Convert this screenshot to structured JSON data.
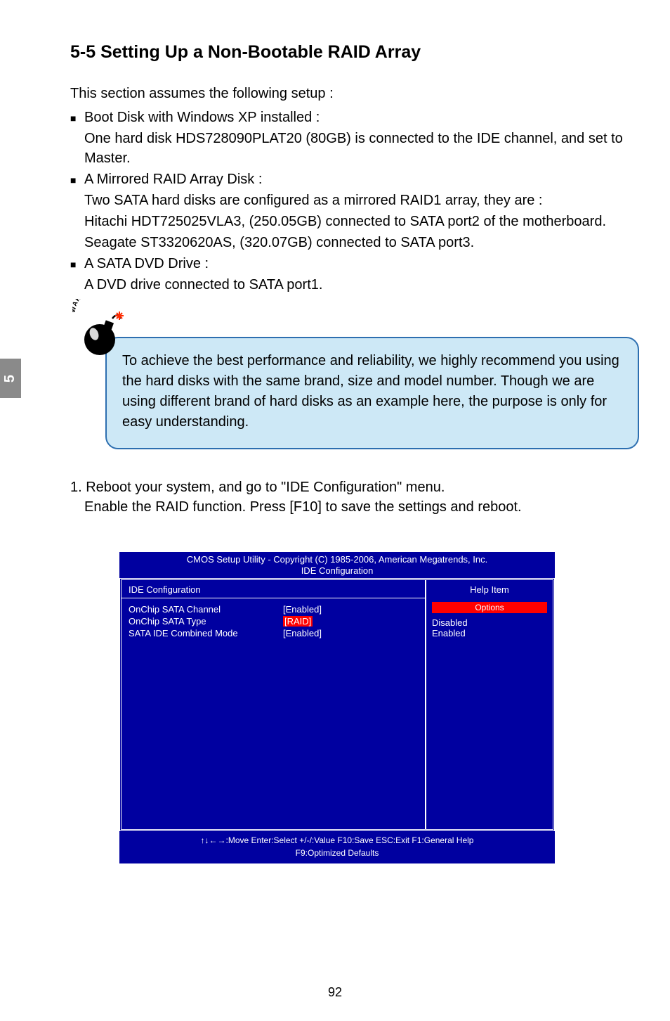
{
  "title": "5-5 Setting Up a Non-Bootable RAID Array",
  "intro": "This section assumes the following setup :",
  "bullets": [
    {
      "head": "Boot Disk with Windows XP installed :",
      "lines": [
        "One hard disk HDS728090PLAT20 (80GB) is connected to the IDE channel, and set to Master."
      ]
    },
    {
      "head": "A Mirrored RAID Array Disk :",
      "lines": [
        "Two SATA hard disks are configured as a mirrored RAID1 array, they are :",
        "Hitachi HDT725025VLA3, (250.05GB) connected to SATA port2 of the motherboard.",
        "Seagate ST3320620AS, (320.07GB) connected to SATA port3."
      ]
    },
    {
      "head": "A SATA DVD Drive :",
      "lines": [
        "A DVD drive connected to SATA port1."
      ]
    }
  ],
  "warning_word": "WARNING!",
  "callout": "To achieve the best performance and reliability, we highly recommend you using the hard disks with the same brand, size and model number. Though we are using different brand of hard disks as an example here, the purpose is only for easy understanding.",
  "step_line1": "1. Reboot your system, and go to \"IDE Configuration\" menu.",
  "step_line2": "Enable the RAID function. Press [F10] to save the settings and reboot.",
  "side_tab": "5",
  "bios": {
    "title": "CMOS Setup Utility - Copyright (C) 1985-2006, American Megatrends, Inc.",
    "subtitle": "IDE Configuration",
    "panel_header": "IDE Configuration",
    "rows": [
      {
        "label": "OnChip SATA Channel",
        "value": "[Enabled]",
        "sel": false
      },
      {
        "label": "OnChip SATA Type",
        "value": "[RAID]",
        "sel": true
      },
      {
        "label": "SATA IDE Combined Mode",
        "value": "[Enabled]",
        "sel": false
      }
    ],
    "help_title": "Help Item",
    "options_header": "Options",
    "options": [
      "Disabled",
      "Enabled"
    ],
    "footer1": "↑↓←→:Move   Enter:Select    +/-/:Value    F10:Save     ESC:Exit    F1:General Help",
    "footer2": "F9:Optimized Defaults"
  },
  "page_number": "92"
}
